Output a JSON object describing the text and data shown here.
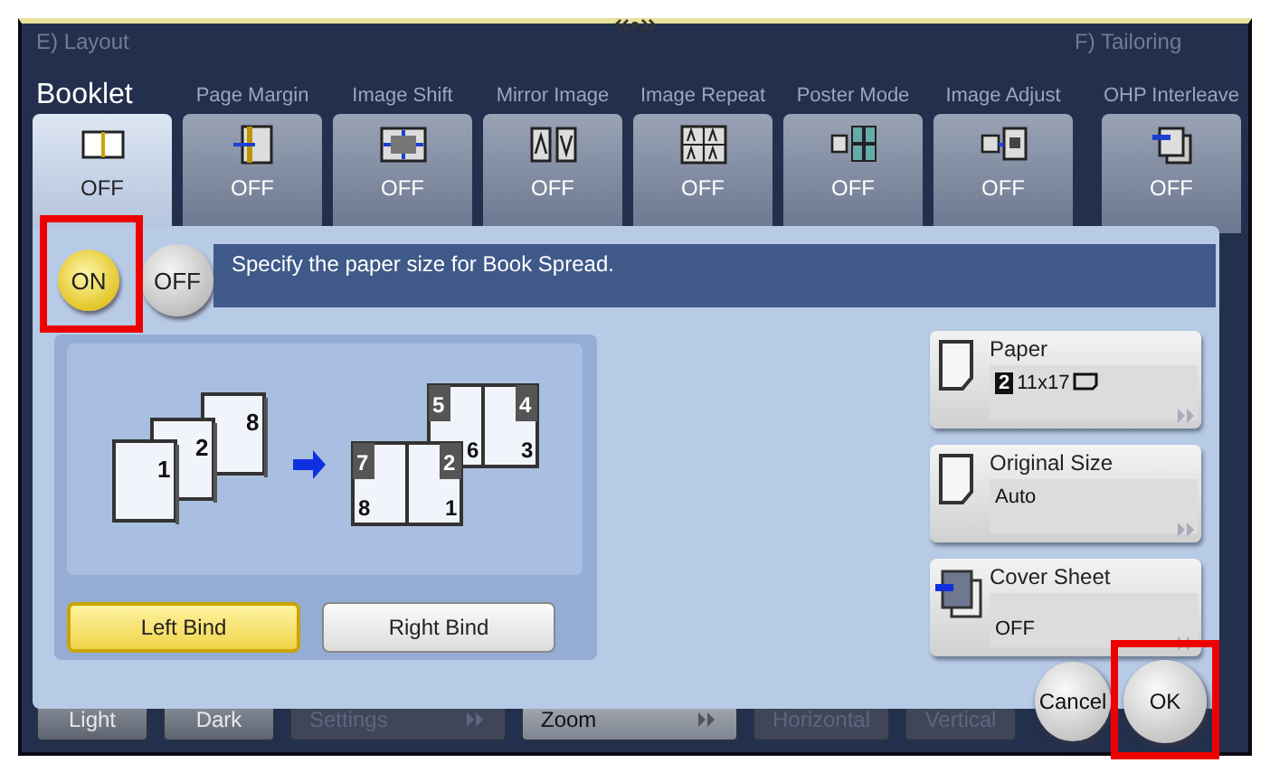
{
  "layout_section": {
    "title": "E)  Layout",
    "functions": [
      {
        "label": "Booklet",
        "state": "OFF",
        "selected": true,
        "kind": "booklet"
      },
      {
        "label": "Page Margin",
        "state": "OFF",
        "selected": false,
        "kind": "margin"
      },
      {
        "label": "Image Shift",
        "state": "OFF",
        "selected": false,
        "kind": "shift"
      },
      {
        "label": "Mirror Image",
        "state": "OFF",
        "selected": false,
        "kind": "mirror"
      },
      {
        "label": "Image Repeat",
        "state": "OFF",
        "selected": false,
        "kind": "repeat"
      },
      {
        "label": "Poster Mode",
        "state": "OFF",
        "selected": false,
        "kind": "poster"
      },
      {
        "label": "Image Adjust",
        "state": "OFF",
        "selected": false,
        "kind": "adjust"
      }
    ]
  },
  "tailoring_section": {
    "title": "F)  Tailoring",
    "functions": [
      {
        "label": "OHP Interleave",
        "state": "OFF",
        "selected": false,
        "kind": "interleave"
      }
    ]
  },
  "bottom_controls": [
    {
      "label": "Light",
      "disabled": false,
      "kind": "button"
    },
    {
      "label": "Dark",
      "disabled": false,
      "kind": "button"
    },
    {
      "label": "Settings",
      "disabled": true,
      "kind": "arrow"
    },
    {
      "label": "Zoom",
      "disabled": false,
      "kind": "arrow"
    },
    {
      "label": "Horizontal",
      "disabled": true,
      "kind": "button"
    },
    {
      "label": "Vertical",
      "disabled": true,
      "kind": "button"
    }
  ],
  "dialog": {
    "toggle": [
      {
        "label": "ON",
        "selected": true
      },
      {
        "label": "OFF",
        "selected": false
      }
    ],
    "message": "Specify the paper size for Book Spread.",
    "diagram": {
      "source_pages": [
        "1",
        "2",
        "8"
      ],
      "spreads": [
        {
          "pages": [
            {
              "corner": "5",
              "folio": "6"
            },
            {
              "corner": "4",
              "folio": "3"
            }
          ]
        },
        {
          "pages": [
            {
              "corner": "7",
              "folio": "8"
            },
            {
              "corner": "2",
              "folio": "1"
            }
          ]
        }
      ]
    },
    "bind": [
      {
        "label": "Left Bind",
        "selected": true
      },
      {
        "label": "Right Bind",
        "selected": false
      }
    ],
    "settings": [
      {
        "kind": "paper",
        "label": "Paper",
        "tray": "2",
        "value": "11x17"
      },
      {
        "kind": "original",
        "label": "Original Size",
        "value": "Auto"
      },
      {
        "kind": "cover",
        "label": "Cover Sheet",
        "value": "OFF"
      }
    ],
    "actions": [
      {
        "label": "Cancel",
        "kind": "cancel"
      },
      {
        "label": "OK",
        "kind": "ok"
      }
    ]
  }
}
